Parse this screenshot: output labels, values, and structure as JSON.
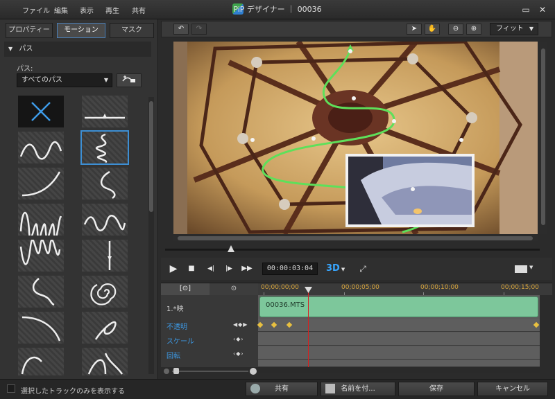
{
  "menu": [
    "ファイル",
    "編集",
    "表示",
    "再生",
    "共有"
  ],
  "window_title": "PiP デザイナー ｜ 00036",
  "window_buttons": {
    "restore": "▭",
    "close": "✕"
  },
  "tabs": [
    "プロパティー",
    "モーション",
    "マスク"
  ],
  "section": {
    "title": "パス",
    "arrow": "▼"
  },
  "path_label": "パス:",
  "path_select": "すべてのパス",
  "path_add_icon": "add-path-icon",
  "fit_select": "フィット",
  "timecode": "00:00:03:04",
  "btn_3d": "3D",
  "ruler": [
    "00;00;00;00",
    "00;00;05;00",
    "00;00;10;00",
    "00;00;15;00"
  ],
  "timeline_tabs": [
    "[⊙]",
    "⊙"
  ],
  "tracks": [
    {
      "label": "1.*映"
    },
    {
      "label": "不透明"
    },
    {
      "label": "スケール"
    },
    {
      "label": "回転"
    }
  ],
  "clip_name": "00036.MTS",
  "bottom": {
    "checkbox_label": "選択したトラックのみを表示する",
    "buttons": [
      "共有",
      "名前を付...",
      "保存",
      "キャンセル"
    ]
  },
  "colors": {
    "accent": "#3d8fd4",
    "clip": "#7dc79b",
    "path": "#5ee05a",
    "playhead": "#d82020"
  }
}
